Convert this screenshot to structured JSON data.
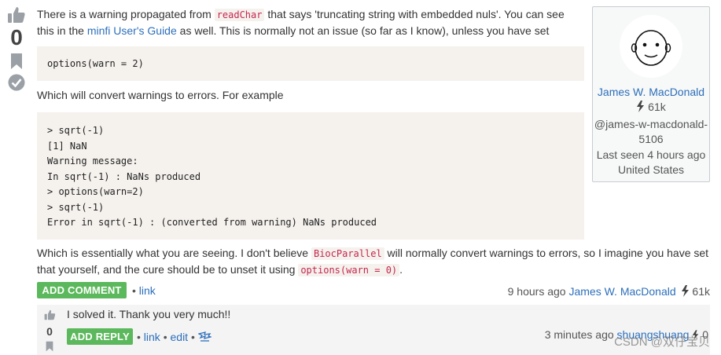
{
  "answer": {
    "vote_count": "0",
    "p1": {
      "part1": "There is a warning propagated from ",
      "code": "readChar",
      "part2": " that says 'truncating string with embedded nuls'. You can see",
      "part3": "this in the ",
      "link": "minfi User's Guide",
      "part4": " as well. This is normally not an issue (so far as I know), unless you have set"
    },
    "code1": "options(warn = 2)",
    "p2": "Which will convert warnings to errors. For example",
    "code2_lines": [
      "> sqrt(-1)",
      "[1] NaN",
      "Warning message:",
      "In sqrt(-1) : NaNs produced",
      "> options(warn=2)",
      "> sqrt(-1)",
      "Error in sqrt(-1) : (converted from warning) NaNs produced"
    ],
    "p3": {
      "part1": "Which is essentially what you are seeing. I don't believe ",
      "code": "BiocParallel",
      "part2": " will normally convert warnings to errors, so I imagine you have set",
      "part3": "that yourself, and the cure should be to unset it using ",
      "code2": "options(warn = 0)",
      "part4": "."
    },
    "add_comment_label": "ADD COMMENT",
    "link_label": "link",
    "timestamp": "9 hours ago",
    "author": "James W. MacDonald",
    "reputation": "61k"
  },
  "user_card": {
    "name": "James W. MacDonald",
    "reputation": "61k",
    "handle_line1": "@james-w-macdonald-",
    "handle_line2": "5106",
    "last_seen": "Last seen 4 hours ago",
    "location": "United States"
  },
  "reply": {
    "text": "I solved it. Thank you very much!!",
    "vote_count": "0",
    "add_reply_label": "ADD REPLY",
    "link_label": "link",
    "edit_label": "edit",
    "timestamp": "3 minutes ago",
    "author": "shuangshuang",
    "reputation": "0"
  },
  "watermark": "CSDN @双仔宝贝",
  "colors": {
    "accent_link": "#2c6fbb",
    "button_green": "#5cb85c",
    "code_bg": "#f5f2ee",
    "inline_code": "#c7254e"
  }
}
